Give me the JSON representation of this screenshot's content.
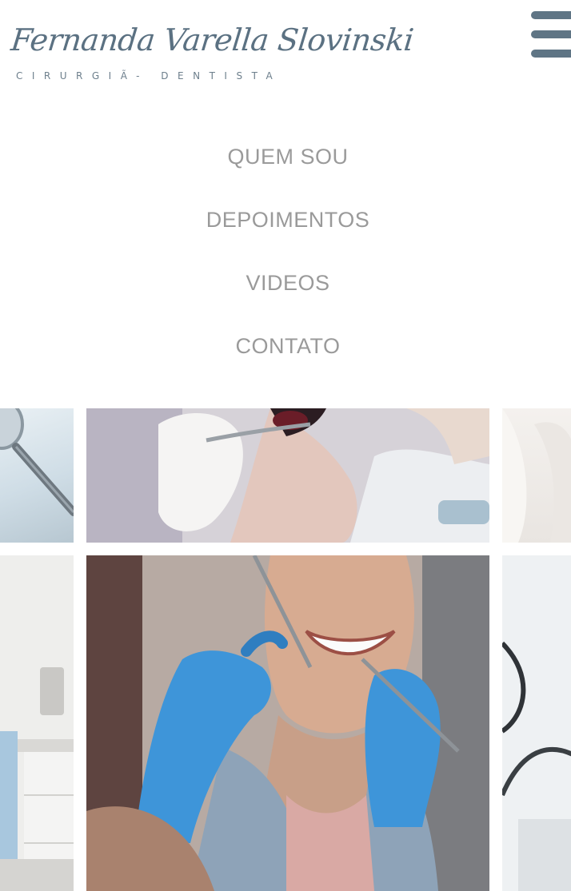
{
  "header": {
    "logo_name": "Fernanda Varella Slovinski",
    "logo_subtitle": "CIRURGIÃ- DENTISTA",
    "menu_icon": "hamburger-menu-icon"
  },
  "nav": {
    "items": [
      {
        "label": "QUEM SOU"
      },
      {
        "label": "DEPOIMENTOS"
      },
      {
        "label": "VIDEOS"
      },
      {
        "label": "CONTATO"
      }
    ]
  },
  "gallery": {
    "photos": [
      {
        "subject": "dental mirror instrument close-up"
      },
      {
        "subject": "gloved hands treating patient's open mouth"
      },
      {
        "subject": "bright dental office detail"
      },
      {
        "subject": "dental clinic cabinets"
      },
      {
        "subject": "smiling patient with dentist holding instruments in blue gloves"
      },
      {
        "subject": "dental equipment hose"
      }
    ]
  },
  "colors": {
    "logo": "#5b7182",
    "menu_icon": "#5f7585",
    "nav_text": "#9a9a9a",
    "glove_blue": "#3e95d9"
  }
}
